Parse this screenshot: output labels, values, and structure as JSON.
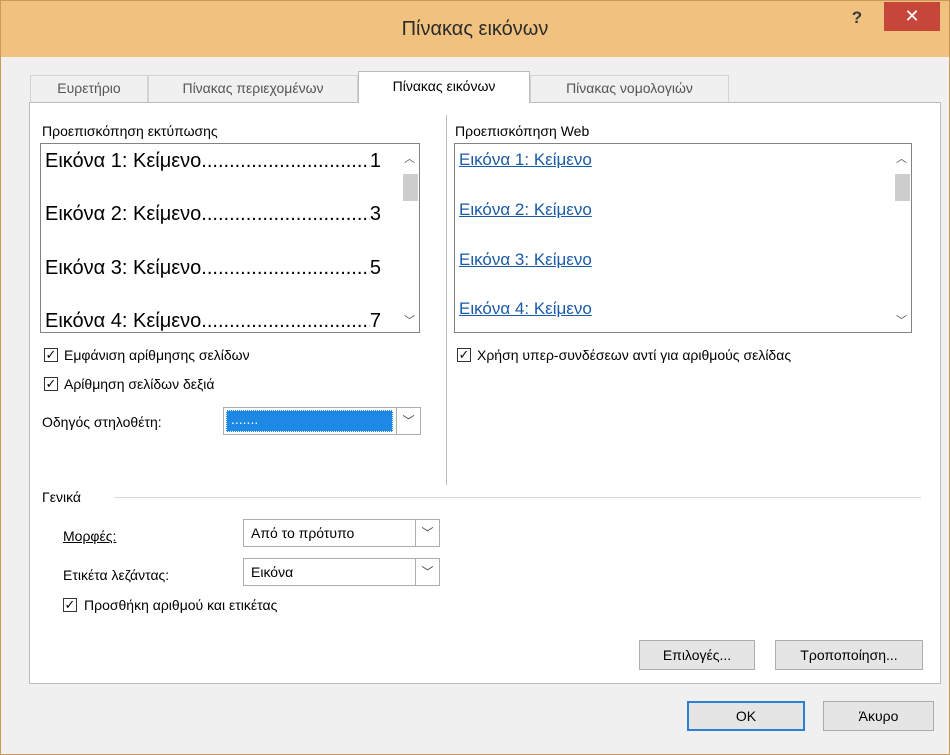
{
  "window": {
    "title": "Πίνακας εικόνων",
    "help_label": "?",
    "close_label": "✕"
  },
  "tabs": [
    {
      "label": "Ευρετήριο",
      "active": false
    },
    {
      "label": "Πίνακας περιεχομένων",
      "active": false
    },
    {
      "label": "Πίνακας εικόνων",
      "active": true
    },
    {
      "label": "Πίνακας νομολογιών",
      "active": false
    }
  ],
  "print_preview": {
    "label": "Προεπισκόπηση εκτύπωσης",
    "entries": [
      {
        "text": "Εικόνα 1: Κείμενο",
        "page": "1"
      },
      {
        "text": "Εικόνα 2: Κείμενο",
        "page": "3"
      },
      {
        "text": "Εικόνα 3: Κείμενο",
        "page": "5"
      },
      {
        "text": "Εικόνα 4: Κείμενο",
        "page": "7"
      }
    ]
  },
  "web_preview": {
    "label": "Προεπισκόπηση Web",
    "entries": [
      "Εικόνα 1: Κείμενο",
      "Εικόνα 2: Κείμενο",
      "Εικόνα 3: Κείμενο",
      "Εικόνα 4: Κείμενο"
    ]
  },
  "options": {
    "show_page_numbers": {
      "label": "Εμφάνιση αρίθμησης σελίδων",
      "checked": true
    },
    "right_align": {
      "label": "Αρίθμηση σελίδων δεξιά",
      "checked": true
    },
    "tab_leader": {
      "label": "Οδηγός στηλοθέτη:",
      "value": "......."
    },
    "use_hyperlinks": {
      "label": "Χρήση υπερ-συνδέσεων αντί για αριθμούς σελίδας",
      "checked": true
    }
  },
  "general": {
    "label": "Γενικά",
    "formats": {
      "label": "Μορφές:",
      "value": "Από το πρότυπο"
    },
    "caption_label": {
      "label": "Ετικέτα λεζάντας:",
      "value": "Εικόνα"
    },
    "include_label": {
      "label": "Προσθήκη αριθμού και ετικέτας",
      "checked": true
    }
  },
  "buttons": {
    "options": "Επιλογές...",
    "modify": "Τροποποίηση...",
    "ok": "OK",
    "cancel": "Άκυρο"
  },
  "colors": {
    "titlebar": "#f1c27f",
    "close": "#c7463a",
    "link": "#1a5aa6",
    "selection": "#1e88e5"
  }
}
